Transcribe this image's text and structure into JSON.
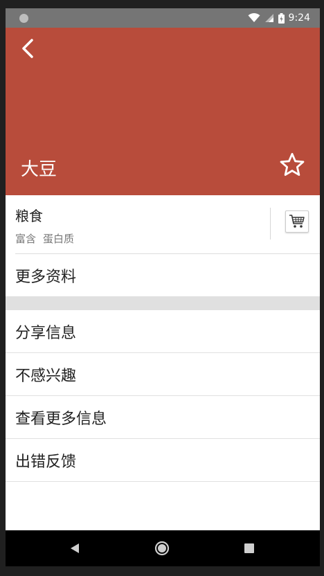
{
  "status_bar": {
    "time": "9:24",
    "icons": [
      "notification-dot-icon",
      "wifi-icon",
      "signal-icon",
      "battery-icon"
    ]
  },
  "header": {
    "title": "大豆",
    "background_color": "#b84c3b",
    "icons": [
      "back-arrow-icon",
      "star-outline-icon"
    ]
  },
  "product": {
    "category": "粮食",
    "tags": [
      "富含",
      "蛋白质"
    ],
    "cart_icon": "shopping-cart-icon"
  },
  "menu": {
    "more_info": "更多资料",
    "share": "分享信息",
    "not_interested": "不感兴趣",
    "view_more": "查看更多信息",
    "feedback": "出错反馈"
  },
  "nav_bar": {
    "icons": [
      "back-triangle-icon",
      "home-circle-icon",
      "recents-square-icon"
    ]
  }
}
